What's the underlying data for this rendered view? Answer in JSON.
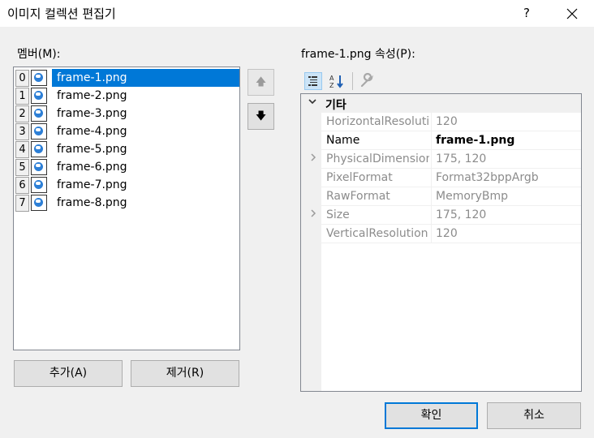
{
  "window": {
    "title": "이미지 컬렉션 편집기",
    "help": "?"
  },
  "members": {
    "label": "멤버(M):",
    "items": [
      {
        "index": "0",
        "name": "frame-1.png",
        "selected": true
      },
      {
        "index": "1",
        "name": "frame-2.png"
      },
      {
        "index": "2",
        "name": "frame-3.png"
      },
      {
        "index": "3",
        "name": "frame-4.png"
      },
      {
        "index": "4",
        "name": "frame-5.png"
      },
      {
        "index": "5",
        "name": "frame-6.png"
      },
      {
        "index": "6",
        "name": "frame-7.png"
      },
      {
        "index": "7",
        "name": "frame-8.png"
      }
    ],
    "add_label": "추가(A)",
    "remove_label": "제거(R)",
    "move_up": "🡅",
    "move_down": "🡇"
  },
  "properties": {
    "label": "frame-1.png 속성(P):",
    "category": "기타",
    "rows": [
      {
        "name": "HorizontalResolution",
        "value": "120"
      },
      {
        "name": "Name",
        "value": "frame-1.png",
        "editable": true
      },
      {
        "name": "PhysicalDimension",
        "value": "175, 120",
        "expandable": true
      },
      {
        "name": "PixelFormat",
        "value": "Format32bppArgb"
      },
      {
        "name": "RawFormat",
        "value": "MemoryBmp"
      },
      {
        "name": "Size",
        "value": "175, 120",
        "expandable": true
      },
      {
        "name": "VerticalResolution",
        "value": "120"
      }
    ]
  },
  "footer": {
    "ok_label": "확인",
    "cancel_label": "취소"
  },
  "icons": {
    "toolbar": [
      "categorized-icon",
      "alphabetical-icon",
      "property-pages-icon"
    ],
    "accent": "#0078d7"
  }
}
